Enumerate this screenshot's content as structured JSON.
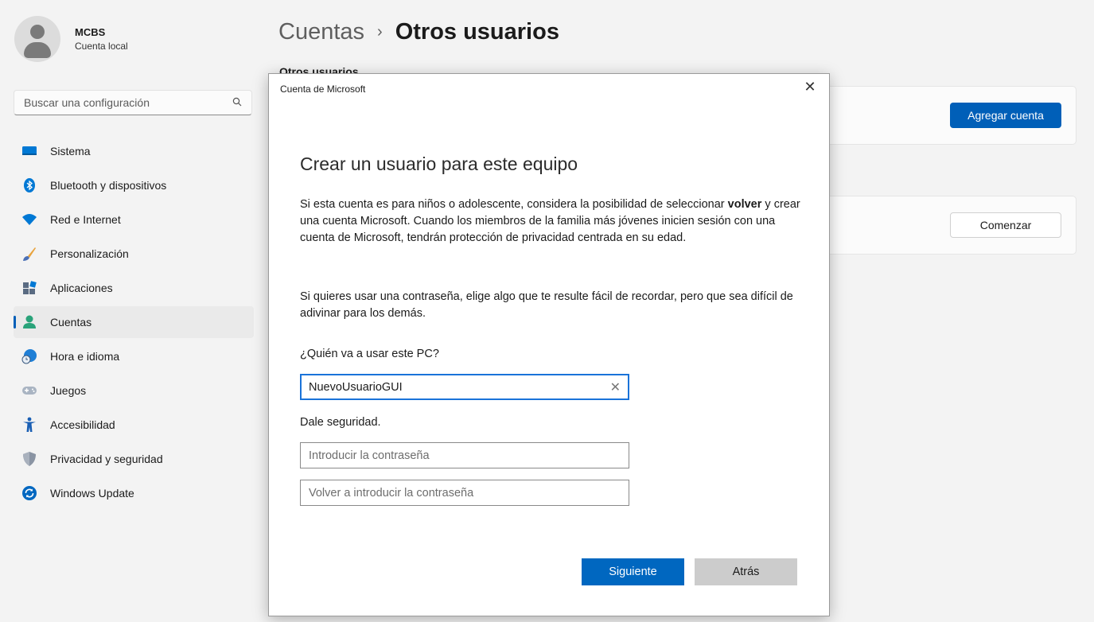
{
  "profile": {
    "name": "MCBS",
    "subtitle": "Cuenta local"
  },
  "search": {
    "placeholder": "Buscar una configuración",
    "icon": "search-icon"
  },
  "sidebar": {
    "items": [
      {
        "label": "Sistema",
        "icon": "system-icon"
      },
      {
        "label": "Bluetooth y dispositivos",
        "icon": "bluetooth-icon"
      },
      {
        "label": "Red e Internet",
        "icon": "wifi-icon"
      },
      {
        "label": "Personalización",
        "icon": "brush-icon"
      },
      {
        "label": "Aplicaciones",
        "icon": "apps-icon"
      },
      {
        "label": "Cuentas",
        "icon": "account-icon",
        "active": true
      },
      {
        "label": "Hora e idioma",
        "icon": "globe-clock-icon"
      },
      {
        "label": "Juegos",
        "icon": "gamepad-icon"
      },
      {
        "label": "Accesibilidad",
        "icon": "accessibility-icon"
      },
      {
        "label": "Privacidad y seguridad",
        "icon": "shield-icon"
      },
      {
        "label": "Windows Update",
        "icon": "update-icon"
      }
    ]
  },
  "breadcrumb": {
    "parent": "Cuentas",
    "separator": "›",
    "current": "Otros usuarios"
  },
  "main": {
    "section_label": "Otros usuarios",
    "add_account_button": "Agregar cuenta",
    "start_button": "Comenzar"
  },
  "dialog": {
    "title": "Cuenta de Microsoft",
    "close": "✕",
    "heading": "Crear un usuario para este equipo",
    "para1_before": "Si esta cuenta es para niños o adolescente, considera la posibilidad de seleccionar ",
    "para1_bold": "volver",
    "para1_after": " y crear una cuenta Microsoft. Cuando los miembros de la familia más jóvenes inicien sesión con una cuenta de Microsoft, tendrán protección de privacidad centrada en su edad.",
    "para2": "Si quieres usar una contraseña, elige algo que te resulte fácil de recordar, pero que sea difícil de adivinar para los demás.",
    "question": "¿Quién va a usar este PC?",
    "username_value": "NuevoUsuarioGUI",
    "clear_glyph": "✕",
    "security_label": "Dale seguridad.",
    "password_placeholder": "Introducir la contraseña",
    "password_confirm_placeholder": "Volver a introducir la contraseña",
    "next_button": "Siguiente",
    "back_button": "Atrás"
  },
  "colors": {
    "accent": "#005fb8",
    "dialog_primary": "#0067c0",
    "focus_border": "#1a73d9"
  }
}
